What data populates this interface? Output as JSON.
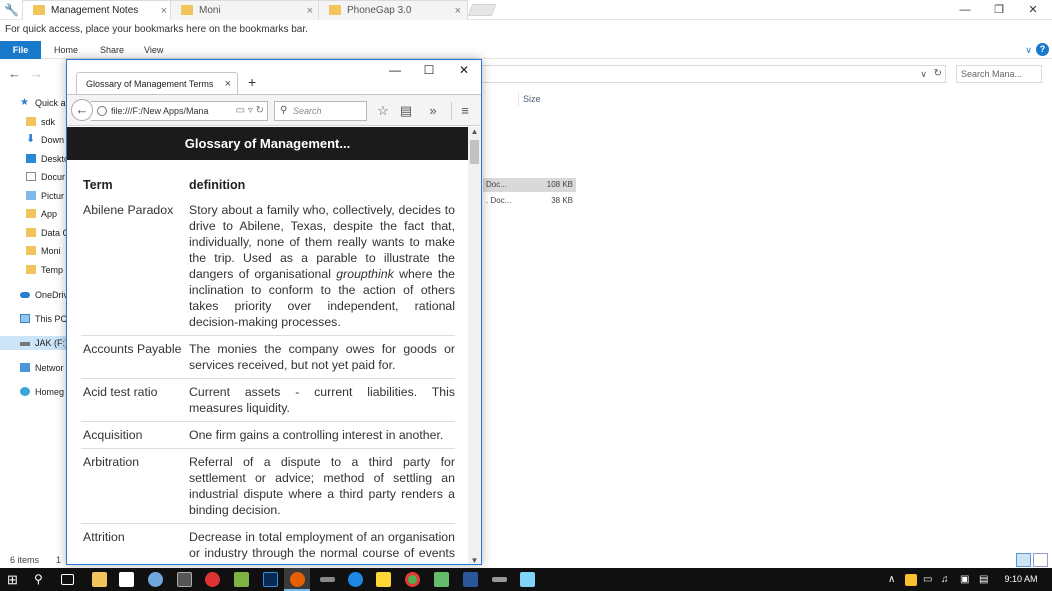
{
  "chrome": {
    "tabs": [
      {
        "label": "Management Notes",
        "close": "×"
      },
      {
        "label": "Moni",
        "close": "×"
      },
      {
        "label": "PhoneGap 3.0",
        "close": "×"
      }
    ],
    "window_controls": {
      "min": "—",
      "max": "❐",
      "close": "✕"
    },
    "bookmarks_hint": "For quick access, place your bookmarks here on the bookmarks bar."
  },
  "explorer": {
    "ribbon": {
      "file": "File",
      "tabs": [
        "Home",
        "Share",
        "View"
      ],
      "help": "?",
      "expand": "∨"
    },
    "nav": {
      "back": "←",
      "forward": "→",
      "up": "↑"
    },
    "address_dropdown": "∨",
    "refresh": "↻",
    "search_placeholder": "Search Mana...",
    "nav_items": [
      {
        "label": "Quick a",
        "icon": "star-icon"
      },
      {
        "label": "sdk",
        "icon": "folder-icon"
      },
      {
        "label": "Down",
        "icon": "download-icon"
      },
      {
        "label": "Deskto",
        "icon": "desktop-icon"
      },
      {
        "label": "Docur",
        "icon": "document-icon"
      },
      {
        "label": "Pictur",
        "icon": "pictures-icon"
      },
      {
        "label": "App",
        "icon": "folder-icon"
      },
      {
        "label": "Data C",
        "icon": "folder-icon"
      },
      {
        "label": "Moni",
        "icon": "folder-icon"
      },
      {
        "label": "Temp",
        "icon": "folder-icon"
      },
      {
        "label": "OneDriv",
        "icon": "cloud-icon"
      },
      {
        "label": "This PC",
        "icon": "computer-icon"
      },
      {
        "label": "JAK (F:)",
        "icon": "drive-icon"
      },
      {
        "label": "Networ",
        "icon": "network-icon"
      },
      {
        "label": "Homeg",
        "icon": "homegroup-icon"
      }
    ],
    "columns": {
      "size": "Size"
    },
    "files": [
      {
        "type": "Doc...",
        "size": "108 KB",
        "selected": true
      },
      {
        "type": ". Doc...",
        "size": "38 KB",
        "selected": false
      }
    ],
    "status": {
      "count": "6 items",
      "extra": "1"
    }
  },
  "firefox": {
    "tab_title": "Glossary of Management Terms",
    "tab_close": "×",
    "new_tab": "+",
    "window_controls": {
      "min": "—",
      "max": "☐",
      "close": "✕"
    },
    "back": "←",
    "url": "file:///F:/New Apps/Mana",
    "url_icons": "▭ ▿ ↻",
    "search_placeholder": "Search",
    "search_glyph": "⚲",
    "toolbar": {
      "bookmark": "☆",
      "library": "▤",
      "overflow": "»",
      "menu": "≡"
    },
    "scroll": {
      "up": "▲",
      "down": "▼"
    }
  },
  "page": {
    "header": "Glossary of Management...",
    "columns": {
      "term": "Term",
      "definition": "definition"
    },
    "rows": [
      {
        "term": "Abilene Paradox",
        "def_pre": "Story about a family who, collectively, decides to drive to Abilene, Texas, despite the fact that, individually, none of them really wants to make the trip. Used as a parable to illustrate the dangers of organisational ",
        "def_em": "groupthink",
        "def_post": " where the inclination to conform to the action of others takes priority over independent, rational decision-making processes."
      },
      {
        "term": "Accounts Payable",
        "def_pre": "The monies the company owes for goods or services received, but not yet paid for.",
        "def_em": "",
        "def_post": ""
      },
      {
        "term": "Acid test ratio",
        "def_pre": "Current assets - current liabilities. This measures liquidity.",
        "def_em": "",
        "def_post": ""
      },
      {
        "term": "Acquisition",
        "def_pre": "One firm gains a controlling interest in another.",
        "def_em": "",
        "def_post": ""
      },
      {
        "term": "Arbitration",
        "def_pre": "Referral of a dispute to a third party for settlement or advice; method of settling an industrial dispute where a third party renders a binding decision.",
        "def_em": "",
        "def_post": ""
      },
      {
        "term": "Attrition",
        "def_pre": "Decrease in total employment of an organisation or industry through the normal course of events such as resignation, retirement or death.",
        "def_em": "",
        "def_post": ""
      }
    ]
  },
  "taskbar": {
    "clock": "9:10 AM",
    "tray_chevron": "∧",
    "colors": {
      "background": "#101010",
      "accent": "#76b9ed"
    }
  }
}
